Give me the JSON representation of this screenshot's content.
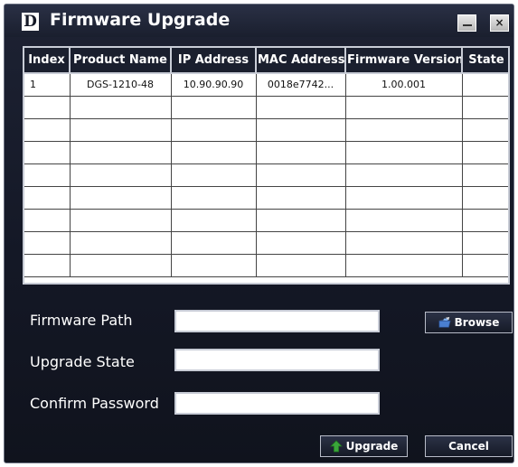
{
  "window": {
    "logo": "D",
    "title": "Firmware Upgrade",
    "minimize_icon": "minimize-icon",
    "close_label": "×"
  },
  "table": {
    "headers": [
      "Index",
      "Product Name",
      "IP Address",
      "MAC Address",
      "Firmware Version",
      "State"
    ],
    "rows": [
      [
        "1",
        "DGS-1210-48",
        "10.90.90.90",
        "0018e7742...",
        "1.00.001",
        ""
      ],
      [
        "",
        "",
        "",
        "",
        "",
        ""
      ],
      [
        "",
        "",
        "",
        "",
        "",
        ""
      ],
      [
        "",
        "",
        "",
        "",
        "",
        ""
      ],
      [
        "",
        "",
        "",
        "",
        "",
        ""
      ],
      [
        "",
        "",
        "",
        "",
        "",
        ""
      ],
      [
        "",
        "",
        "",
        "",
        "",
        ""
      ],
      [
        "",
        "",
        "",
        "",
        "",
        ""
      ],
      [
        "",
        "",
        "",
        "",
        "",
        ""
      ]
    ]
  },
  "form": {
    "firmware_path_label": "Firmware Path",
    "firmware_path_value": "",
    "upgrade_state_label": "Upgrade State",
    "upgrade_state_value": "",
    "confirm_password_label": "Confirm Password",
    "confirm_password_value": ""
  },
  "buttons": {
    "browse": "Browse",
    "browse_icon": "folder-open-icon",
    "upgrade": "Upgrade",
    "upgrade_icon": "green-arrow-up-icon",
    "cancel": "Cancel"
  },
  "colors": {
    "window_bg": "#141826",
    "accent_green": "#3aa63a",
    "folder_blue": "#4a7fd0"
  }
}
